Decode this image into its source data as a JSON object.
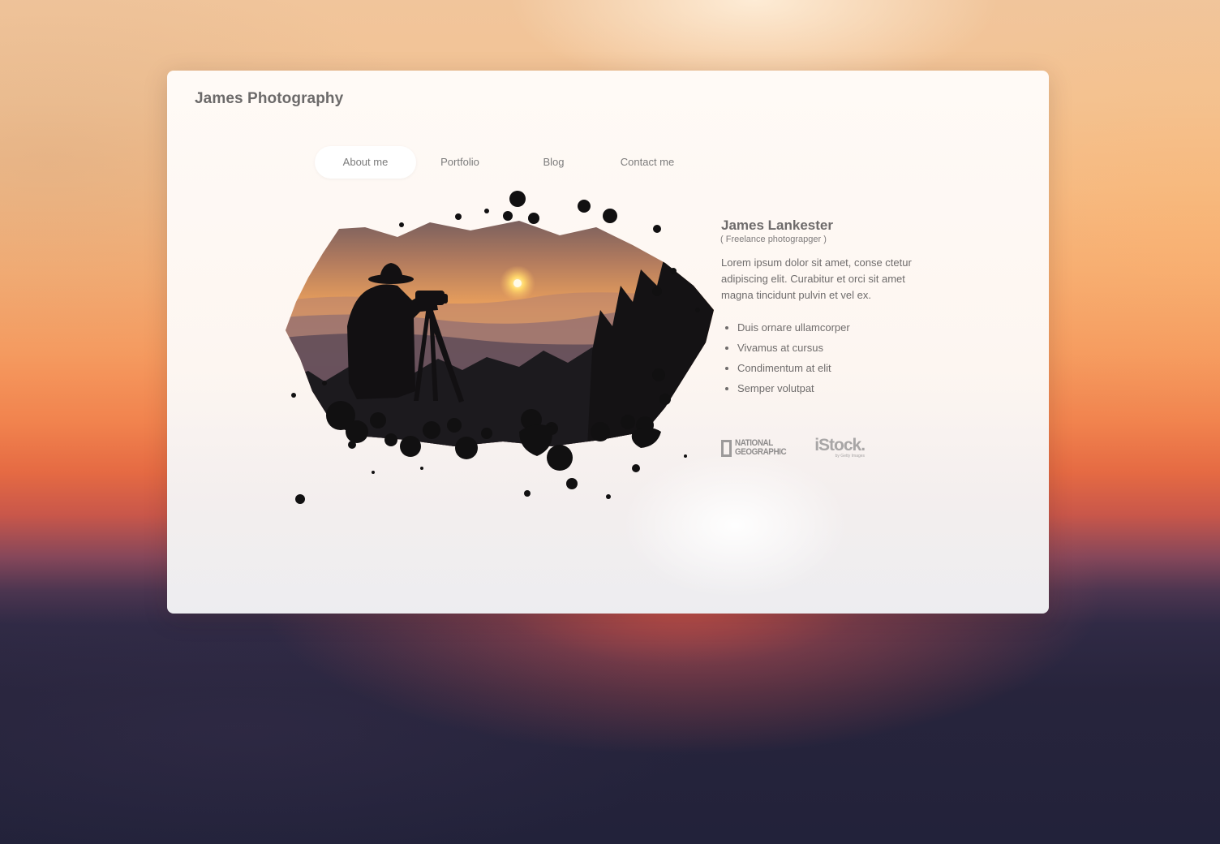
{
  "brand": {
    "title": "James Photography"
  },
  "nav": {
    "items": [
      {
        "label": "About me",
        "active": true
      },
      {
        "label": "Portfolio",
        "active": false
      },
      {
        "label": "Blog",
        "active": false
      },
      {
        "label": "Contact me",
        "active": false
      }
    ]
  },
  "bio": {
    "name": "James Lankester",
    "role": "( Freelance photograpger )",
    "text": "Lorem ipsum dolor sit amet, conse ctetur adipiscing elit. Curabitur et orci sit amet magna tincidunt pulvin et vel ex.",
    "list": [
      "Duis ornare ullamcorper",
      "Vivamus at cursus",
      "Condimentum at elit",
      "Semper volutpat"
    ]
  },
  "logos": {
    "natgeo_line1": "NATIONAL",
    "natgeo_line2": "GEOGRAPHIC",
    "istock_word": "iStock.",
    "istock_sub": "by Getty Images"
  },
  "colors": {
    "sky_top": "#f1c59b",
    "sky_orange": "#f1834e",
    "night": "#22223a",
    "card_bg": "#fffaf6",
    "text": "#6d6a6a"
  }
}
